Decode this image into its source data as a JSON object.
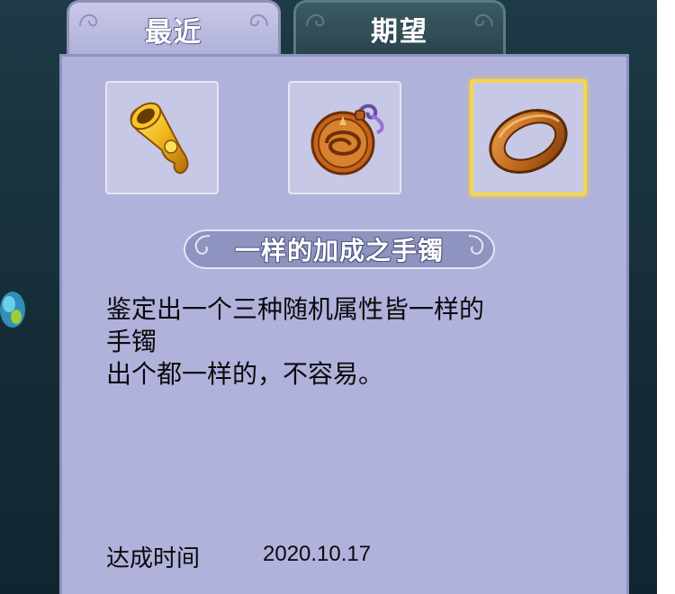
{
  "tabs": [
    {
      "label": "最近"
    },
    {
      "label": "期望"
    }
  ],
  "slots": [
    {
      "icon": "golden-horn-icon",
      "selected": false
    },
    {
      "icon": "bronze-medallion-icon",
      "selected": false
    },
    {
      "icon": "bronze-bracelet-icon",
      "selected": true
    }
  ],
  "achievement": {
    "title": "一样的加成之手镯",
    "description_lines": [
      "鉴定出一个三种随机属性皆一样的",
      "手镯",
      "出个都一样的，不容易。"
    ],
    "time_label": "达成时间",
    "time_value": "2020.10.17"
  },
  "colors": {
    "panel": "#b0b2dc",
    "selected_border": "#f6d64a",
    "background": "#1d3a46"
  }
}
